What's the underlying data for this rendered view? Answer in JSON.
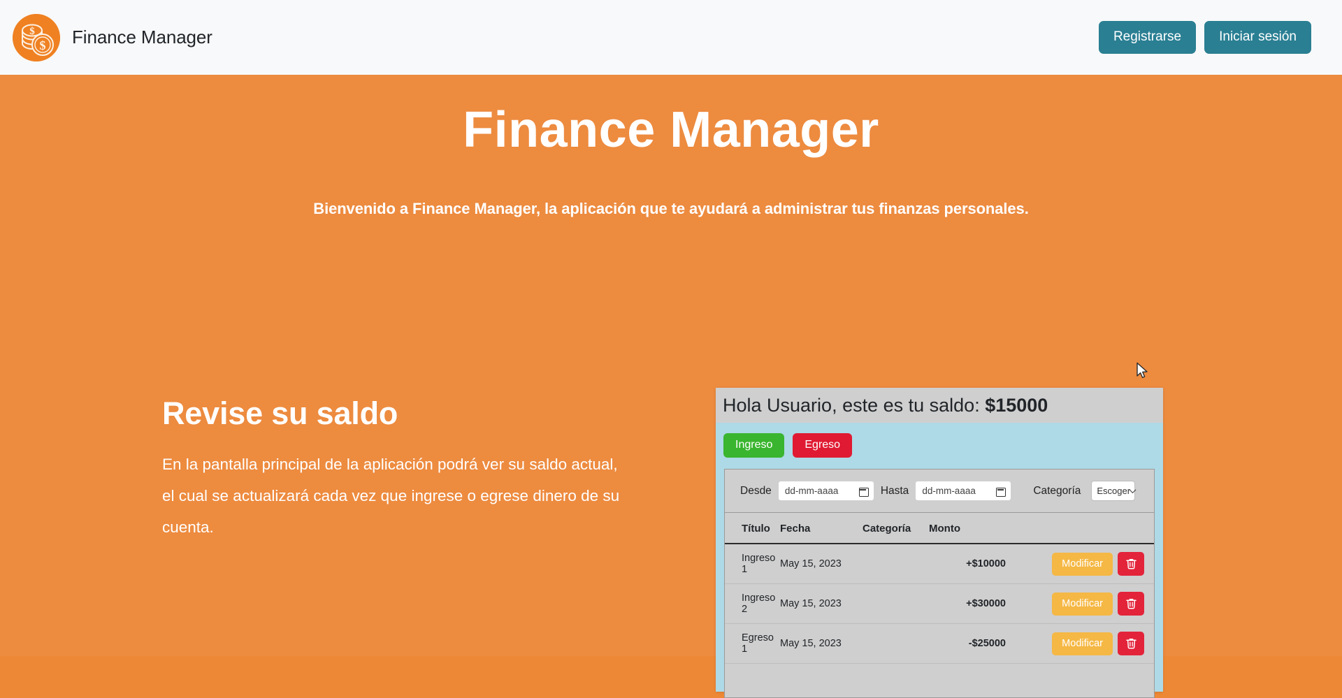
{
  "navbar": {
    "logo_icon": "coins-dollar-icon",
    "brand": "Finance Manager",
    "register_label": "Registrarse",
    "login_label": "Iniciar sesión",
    "brand_color": "#ef8122",
    "button_color": "#2a7f93"
  },
  "hero": {
    "title": "Finance Manager",
    "subtitle": "Bienvenido a Finance Manager, la aplicación que te ayudará a administrar tus finanzas personales.",
    "background_color": "#ed8b3f"
  },
  "feature": {
    "title": "Revise su saldo",
    "body": "En la pantalla principal de la aplicación podrá ver su saldo actual, el cual se actualizará cada vez que ingrese o egrese dinero de su cuenta."
  },
  "preview": {
    "greeting_prefix": "Hola Usuario, este es tu saldo: ",
    "balance": "$15000",
    "income_button": "Ingreso",
    "expense_button": "Egreso",
    "income_color": "#3ab52f",
    "expense_color": "#e01a32",
    "filters": {
      "from_label": "Desde",
      "from_value": "dd-mm-aaaa",
      "from_icon": "calendar-icon",
      "to_label": "Hasta",
      "to_value": "dd-mm-aaaa",
      "to_icon": "calendar-icon",
      "category_label": "Categoría",
      "category_value": "Escoger",
      "category_icon": "chevron-down-icon"
    },
    "table": {
      "headers": [
        "Título",
        "Fecha",
        "Categoría",
        "Monto"
      ],
      "rows": [
        {
          "titulo": "Ingreso 1",
          "fecha": "May 15, 2023",
          "categoria": "",
          "monto": "+$10000",
          "sign": "positive",
          "edit_label": "Modificar",
          "delete_icon": "trash-icon"
        },
        {
          "titulo": "Ingreso 2",
          "fecha": "May 15, 2023",
          "categoria": "",
          "monto": "+$30000",
          "sign": "positive",
          "edit_label": "Modificar",
          "delete_icon": "trash-icon"
        },
        {
          "titulo": "Egreso 1",
          "fecha": "May 15, 2023",
          "categoria": "",
          "monto": "-$25000",
          "sign": "negative",
          "edit_label": "Modificar",
          "delete_icon": "trash-icon"
        }
      ]
    },
    "edit_color": "#f5b845",
    "delete_color": "#e3233a",
    "positive_color": "#1e7e34",
    "negative_color": "#e3342f",
    "panel_bg": "#aed9e6"
  },
  "cursor": {
    "icon": "mouse-pointer-icon"
  }
}
